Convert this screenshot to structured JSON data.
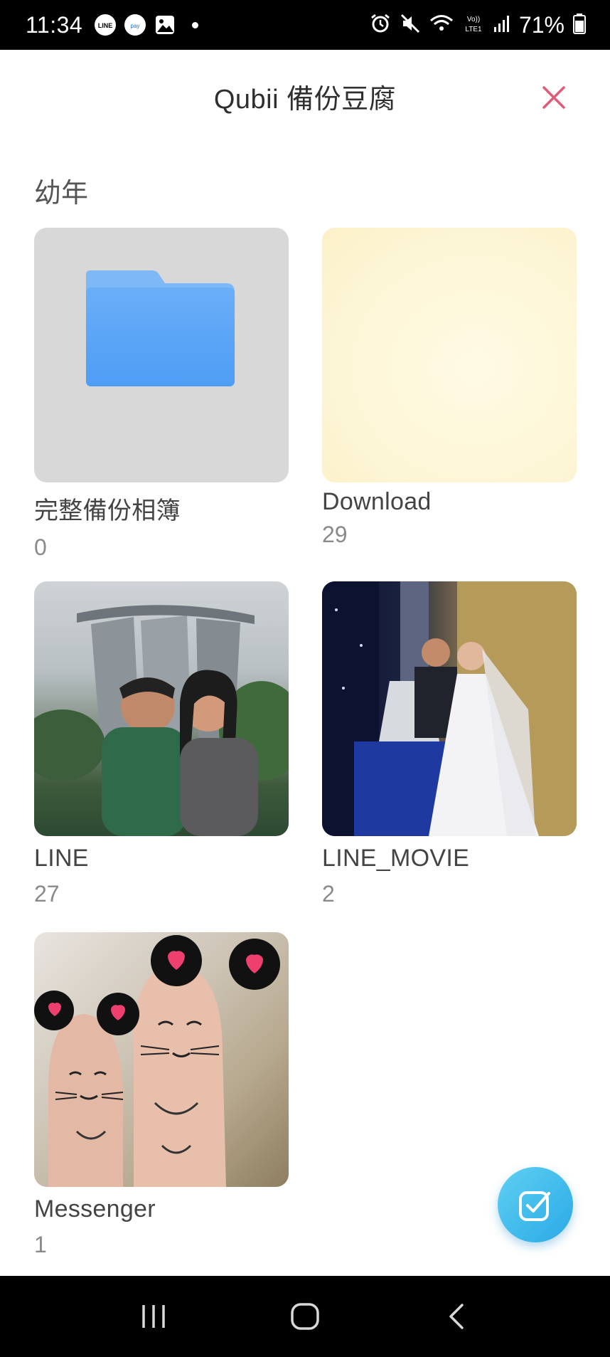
{
  "status_bar": {
    "time": "11:34",
    "battery_percent": "71%",
    "notification_icons": [
      "line-icon",
      "pay-icon",
      "image-icon"
    ]
  },
  "header": {
    "title": "Qubii 備份豆腐",
    "close_icon": "close-icon",
    "close_color": "#e05a78"
  },
  "section": {
    "title": "幼年"
  },
  "albums": [
    {
      "name": "完整備份相簿",
      "count": "0",
      "thumb": "folder-icon"
    },
    {
      "name": "Download",
      "count": "29",
      "thumb": "photo"
    },
    {
      "name": "LINE",
      "count": "27",
      "thumb": "photo"
    },
    {
      "name": "LINE_MOVIE",
      "count": "2",
      "thumb": "photo"
    },
    {
      "name": "Messenger",
      "count": "1",
      "thumb": "photo"
    }
  ],
  "fab": {
    "icon": "checkbox-icon",
    "color": "#2ba9e6"
  },
  "nav_bar": {
    "icons": [
      "recents-icon",
      "home-icon",
      "back-icon"
    ]
  }
}
